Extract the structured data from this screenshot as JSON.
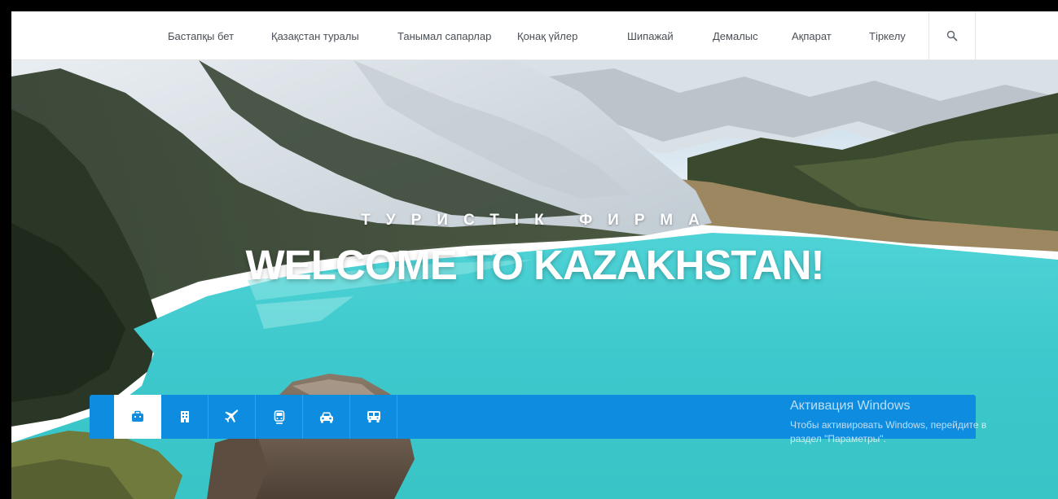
{
  "nav": {
    "items": [
      {
        "label": "Бастапқы бет"
      },
      {
        "label": "Қазақстан туралы"
      },
      {
        "label": "Танымал сапарлар"
      },
      {
        "label": "Қонақ үйлер"
      },
      {
        "label": "Шипажай"
      },
      {
        "label": "Демалыс"
      },
      {
        "label": "Ақпарат"
      },
      {
        "label": "Тіркелу"
      }
    ],
    "search_icon": "search-icon"
  },
  "hero": {
    "subtitle": "ТУРИСТІК ФИРМА",
    "title": "WELCOME TO KAZAKHSTAN!"
  },
  "search_tabs": [
    {
      "icon": "briefcase-icon",
      "active": true
    },
    {
      "icon": "hotel-icon",
      "active": false
    },
    {
      "icon": "plane-icon",
      "active": false
    },
    {
      "icon": "train-icon",
      "active": false
    },
    {
      "icon": "car-icon",
      "active": false
    },
    {
      "icon": "bus-icon",
      "active": false
    }
  ],
  "windows_activation": {
    "title": "Активация Windows",
    "line1": "Чтобы активировать Windows, перейдите в",
    "line2": "раздел \"Параметры\"."
  },
  "colors": {
    "accent": "#0d8ce0",
    "lake": "#3fcdd0",
    "nav_text": "#4a4f57"
  }
}
